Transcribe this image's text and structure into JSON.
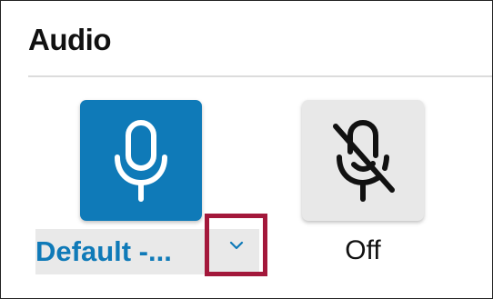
{
  "panel": {
    "title": "Audio"
  },
  "microphone": {
    "device_label": "Default -...",
    "accent_color": "#0f7ab8",
    "icon": "microphone-icon"
  },
  "mute": {
    "label": "Off",
    "icon": "microphone-off-icon"
  },
  "dropdown": {
    "icon": "chevron-down-icon",
    "highlight_color": "#a3183b"
  }
}
